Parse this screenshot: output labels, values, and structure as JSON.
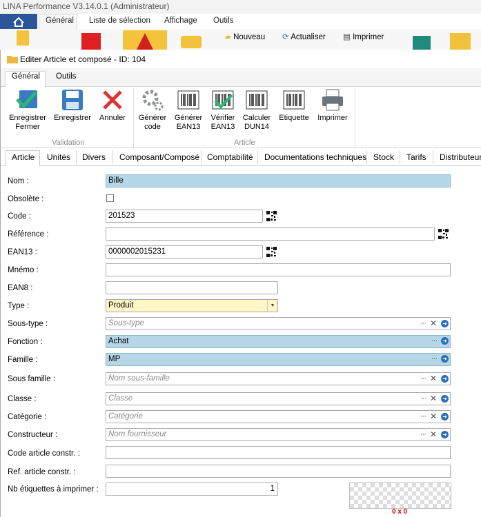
{
  "app": {
    "title": "LINA Performance  V3.14.0.1  (Administrateur)",
    "tabs": [
      "Général",
      "Liste de sélection",
      "Affichage",
      "Outils"
    ],
    "toolbar": {
      "nouveau": "Nouveau",
      "actualiser": "Actualiser",
      "imprimer": "Imprimer"
    }
  },
  "dialog": {
    "title": "Editer Article et composé - ID: 104",
    "tabs": [
      "Général",
      "Outils"
    ],
    "buttons": {
      "save_close": [
        "Enregistrer",
        "Fermer"
      ],
      "save": "Enregistrer",
      "cancel": "Annuler",
      "gen_code": [
        "Générer",
        "code"
      ],
      "gen_ean": [
        "Générer",
        "EAN13"
      ],
      "verify_ean": [
        "Vérifier",
        "EAN13"
      ],
      "calc_dun": [
        "Calculer",
        "DUN14"
      ],
      "label": "Etiquette",
      "print": "Imprimer"
    },
    "groups": {
      "validation": "Validation",
      "article": "Article"
    },
    "form_tabs": [
      "Article",
      "Unités",
      "Divers",
      "Composant/Composé",
      "Comptabilité",
      "Documentations techniques",
      "Stock",
      "Tarifs",
      "Distributeurs"
    ]
  },
  "form": {
    "nom": {
      "label": "Nom :",
      "value": "Bille"
    },
    "obsolete": {
      "label": "Obsolète :",
      "checked": false
    },
    "code": {
      "label": "Code :",
      "value": "201523"
    },
    "reference": {
      "label": "Référence :",
      "value": ""
    },
    "ean13": {
      "label": "EAN13 :",
      "value": "0000002015231"
    },
    "mnemo": {
      "label": "Mnémo :",
      "value": ""
    },
    "ean8": {
      "label": "EAN8 :",
      "value": ""
    },
    "type": {
      "label": "Type :",
      "value": "Produit"
    },
    "sous_type": {
      "label": "Sous-type :",
      "placeholder": "Sous-type"
    },
    "fonction": {
      "label": "Fonction :",
      "value": "Achat"
    },
    "famille": {
      "label": "Famille :",
      "value": "MP"
    },
    "sous_famille": {
      "label": "Sous famille :",
      "placeholder": "Nom sous-famille"
    },
    "classe": {
      "label": "Classe :",
      "placeholder": "Classe"
    },
    "categorie": {
      "label": "Catégorie :",
      "placeholder": "Catégorie"
    },
    "constructeur": {
      "label": "Constructeur :",
      "placeholder": "Nom fournisseur"
    },
    "code_constr": {
      "label": "Code article constr. :",
      "value": ""
    },
    "ref_constr": {
      "label": "Ref. article constr. :",
      "value": ""
    },
    "nb_etiquettes": {
      "label": "Nb étiquettes à imprimer :",
      "value": "1"
    },
    "preview_caption": "0 x 0"
  },
  "colors": {
    "blue_field": "#b5d7e8",
    "yellow_field": "#fff6c6",
    "accent": "#2b579a"
  }
}
